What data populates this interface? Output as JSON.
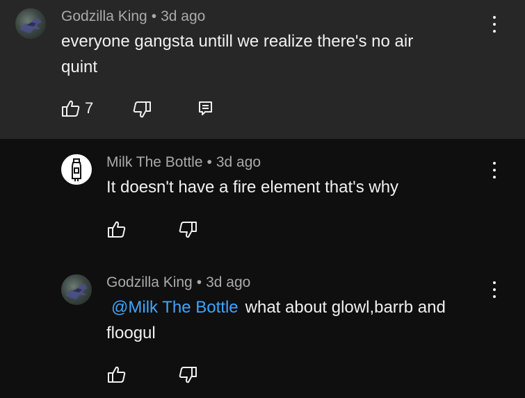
{
  "comments": [
    {
      "author": "Godzilla King",
      "separator": "•",
      "time": "3d ago",
      "text_line1": "everyone gangsta untill we realize there's no air",
      "text_line2": "quint",
      "like_count": "7"
    },
    {
      "author": "Milk The Bottle",
      "separator": "•",
      "time": "3d ago",
      "text_line1": "It doesn't have a fire element that's why"
    },
    {
      "author": "Godzilla King",
      "separator": "•",
      "time": "3d ago",
      "mention": "@Milk The Bottle",
      "text_line1": "what about glowl,barrb and",
      "text_line2": "floogul"
    }
  ],
  "icons": {
    "like": "thumbs-up-icon",
    "dislike": "thumbs-down-icon",
    "reply": "reply-icon",
    "more": "more-vertical-icon"
  },
  "colors": {
    "highlight_bg": "#272727",
    "page_bg": "#0f0f0f",
    "mention": "#3ea6ff",
    "meta_text": "#aaaaaa"
  }
}
